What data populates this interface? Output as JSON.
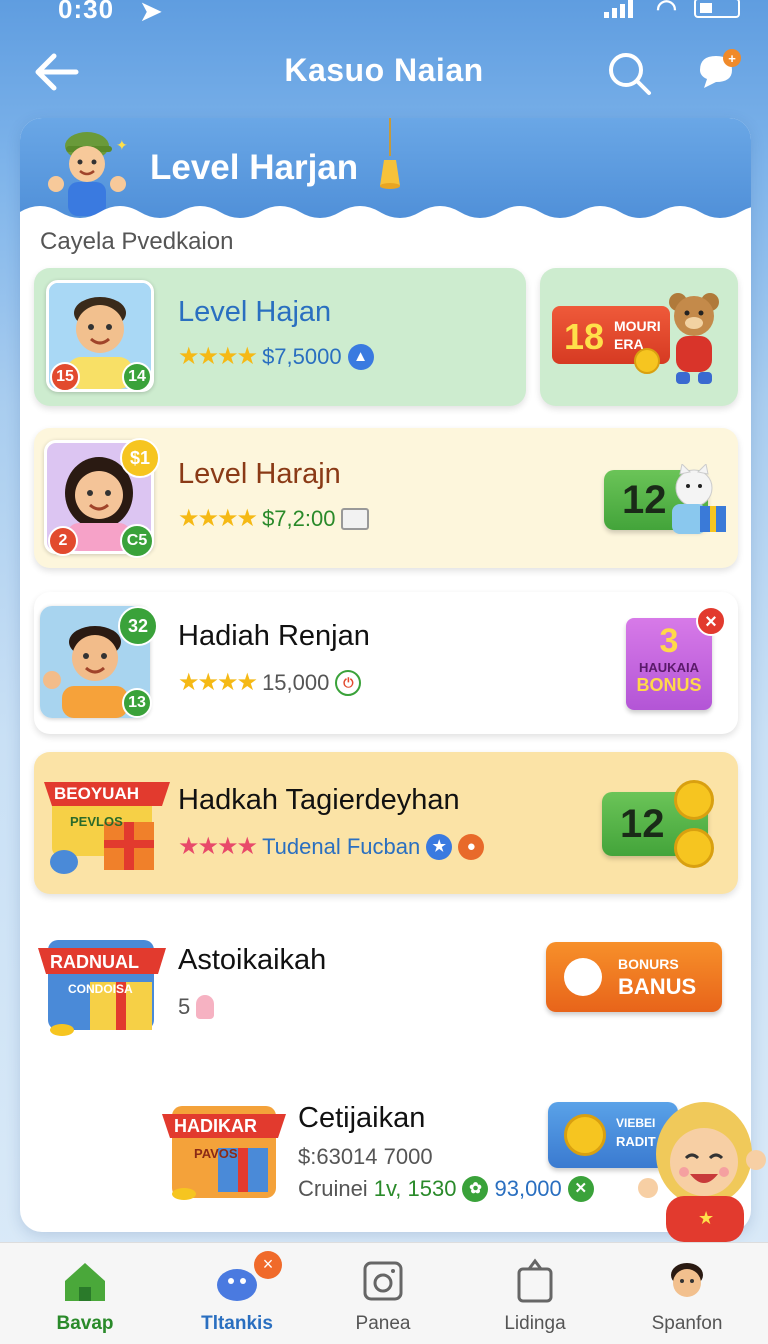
{
  "status_bar": {
    "time": "0:30"
  },
  "nav": {
    "title": "Kasuo Naian"
  },
  "header": {
    "title": "Level Harjan"
  },
  "subtitle": "Cayela Pvedkaion",
  "rows": [
    {
      "name": "Level Hajan",
      "stars": "★★★★",
      "amount": "$7,5000",
      "badge_left": "15",
      "badge_right": "14",
      "reward": {
        "number": "18",
        "text1": "MOURI",
        "text2": "ERA"
      }
    },
    {
      "name": "Level Harajn",
      "stars": "★★★★",
      "amount": "$7,2:00",
      "badge_top": "$1",
      "badge_left": "2",
      "badge_right": "C5",
      "reward": {
        "number": "12"
      }
    },
    {
      "name": "Hadiah Renjan",
      "stars": "★★★★",
      "amount": "15,000",
      "badge_top": "32",
      "badge_right": "13",
      "reward": {
        "number": "3",
        "text1": "HAUKAIA",
        "text2": "BONUS"
      }
    },
    {
      "name": "Hadkah Tagierdeyhan",
      "stars": "★★★★",
      "amount": "Tudenal Fucban",
      "banner": "BEOYUAH",
      "banner_sub": "PEVLOS",
      "reward": {
        "number": "12"
      }
    },
    {
      "name": "Astoikaikah",
      "amount": "5",
      "banner": "RADNUAL",
      "banner_sub": "CONDOISA",
      "reward": {
        "text1": "BONURS",
        "text2": "BANUS"
      }
    },
    {
      "name": "Cetijaikan",
      "line1": "$:63014 7000",
      "line2_label": "Cruinei",
      "line2_a": "1v, 1530",
      "line2_b": "93,000",
      "banner": "HADIKAR",
      "banner_sub": "PAVOS",
      "reward": {
        "text1": "VIEBEI",
        "text2": "RADIT"
      }
    }
  ],
  "tabs": [
    {
      "label": "Bavap"
    },
    {
      "label": "Tltankis"
    },
    {
      "label": "Panea"
    },
    {
      "label": "Lidinga"
    },
    {
      "label": "Spanfon"
    }
  ]
}
